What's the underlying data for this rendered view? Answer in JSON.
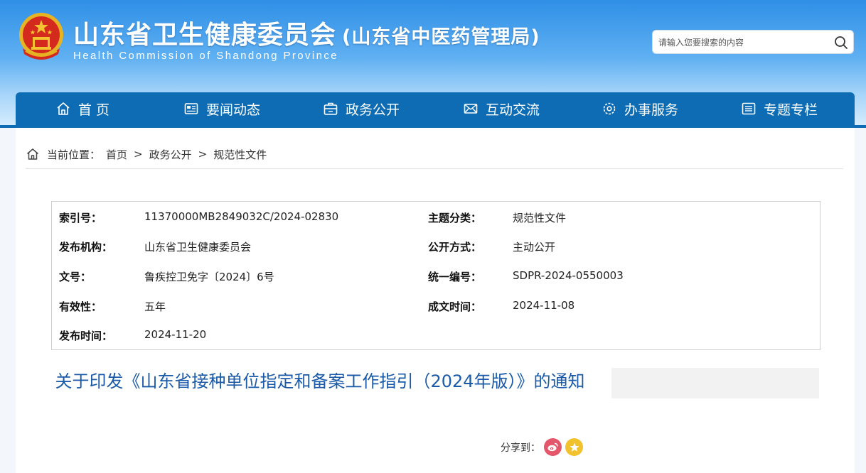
{
  "header": {
    "title": "山东省卫生健康委员会",
    "subtitle": "(山东省中医药管理局)",
    "title_en": "Health Commission of Shandong Province",
    "search_placeholder": "请输入您要搜索的内容"
  },
  "nav": {
    "items": [
      {
        "label": "首 页",
        "icon": "home-icon"
      },
      {
        "label": "要闻动态",
        "icon": "news-icon"
      },
      {
        "label": "政务公开",
        "icon": "briefcase-icon"
      },
      {
        "label": "互动交流",
        "icon": "mail-icon"
      },
      {
        "label": "办事服务",
        "icon": "service-icon"
      },
      {
        "label": "专题专栏",
        "icon": "list-icon"
      }
    ]
  },
  "breadcrumb": {
    "label": "当前位置：",
    "items": [
      "首页",
      "政务公开",
      "规范性文件"
    ],
    "separator": ">"
  },
  "meta": {
    "index_no_label": "索引号：",
    "index_no": "11370000MB2849032C/2024-02830",
    "topic_label": "主题分类：",
    "topic": "规范性文件",
    "publisher_label": "发布机构：",
    "publisher": "山东省卫生健康委员会",
    "disclosure_label": "公开方式：",
    "disclosure": "主动公开",
    "doc_no_label": "文号：",
    "doc_no": "鲁疾控卫免字〔2024〕6号",
    "unified_no_label": "统一编号：",
    "unified_no": "SDPR-2024-0550003",
    "validity_label": "有效性：",
    "validity": "五年",
    "created_label": "成文时间：",
    "created": "2024-11-08",
    "published_label": "发布时间：",
    "published": "2024-11-20"
  },
  "document": {
    "title": "关于印发《山东省接种单位指定和备案工作指引（2024年版）》的通知"
  },
  "share": {
    "label": "分享到："
  },
  "colors": {
    "nav_bg": "#0d6cb3",
    "title_color": "#1a5aa8",
    "weibo": "#e4566a",
    "favorite": "#f2c12e"
  }
}
